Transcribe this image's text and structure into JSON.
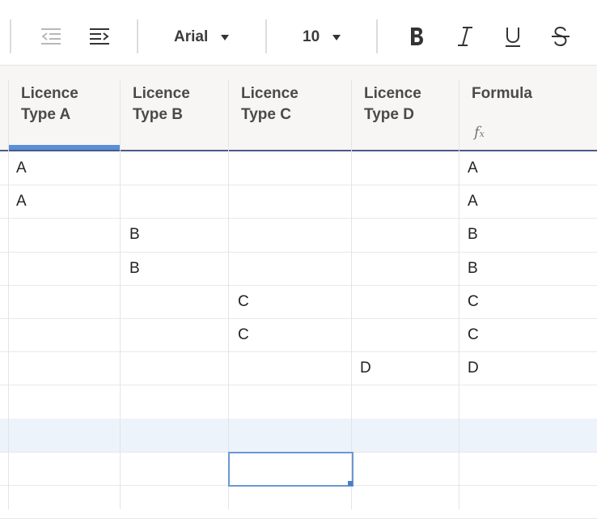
{
  "toolbar": {
    "font_family": "Arial",
    "font_size": "10"
  },
  "headers": [
    {
      "line1": "Licence",
      "line2": "Type A"
    },
    {
      "line1": "Licence",
      "line2": "Type B"
    },
    {
      "line1": "Licence",
      "line2": "Type C"
    },
    {
      "line1": "Licence",
      "line2": "Type D"
    },
    {
      "line1": "Formula",
      "line2": ""
    }
  ],
  "formula_icon": "fx",
  "rows": [
    [
      "A",
      "",
      "",
      "",
      "A"
    ],
    [
      "A",
      "",
      "",
      "",
      "A"
    ],
    [
      "",
      "B",
      "",
      "",
      "B"
    ],
    [
      "",
      "B",
      "",
      "",
      "B"
    ],
    [
      "",
      "",
      "C",
      "",
      "C"
    ],
    [
      "",
      "",
      "C",
      "",
      "C"
    ],
    [
      "",
      "",
      "",
      "D",
      "D"
    ],
    [
      "",
      "",
      "",
      "",
      ""
    ],
    [
      "",
      "",
      "",
      "",
      ""
    ],
    [
      "",
      "",
      "",
      "",
      ""
    ],
    [
      "",
      "",
      "",
      "",
      ""
    ]
  ],
  "colors": {
    "accent": "#5b8fd6",
    "header_bg": "#f7f6f4",
    "highlight_row": "#edf3fb"
  }
}
